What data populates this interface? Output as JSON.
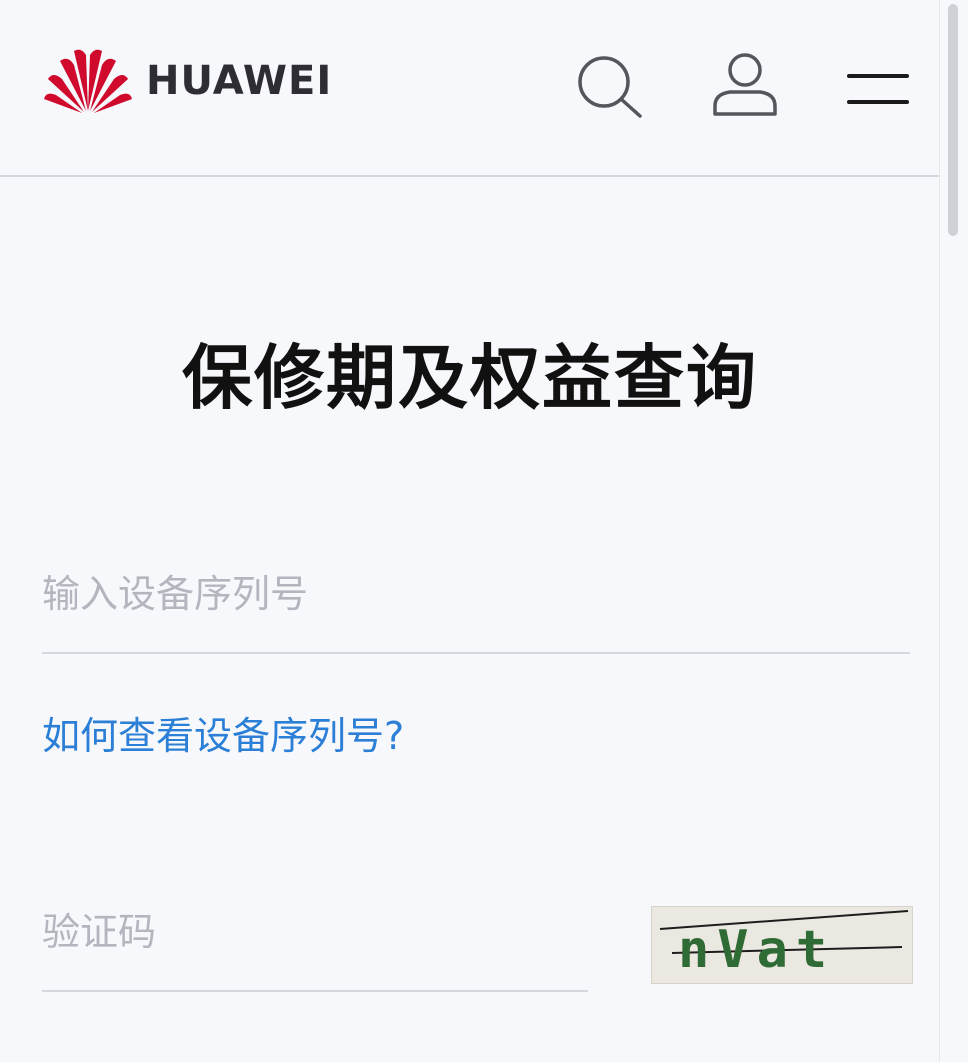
{
  "header": {
    "brand": "HUAWEI",
    "brand_color": "#cf0a2c",
    "icons": {
      "search": "search-icon",
      "user": "user-icon",
      "menu": "hamburger-menu-icon"
    }
  },
  "main": {
    "title": "保修期及权益查询",
    "serial_input": {
      "placeholder": "输入设备序列号",
      "value": ""
    },
    "help_link": "如何查看设备序列号?",
    "help_link_color": "#2b7fd6",
    "captcha_input": {
      "placeholder": "验证码",
      "value": ""
    },
    "captcha_image_text": "nVat"
  }
}
